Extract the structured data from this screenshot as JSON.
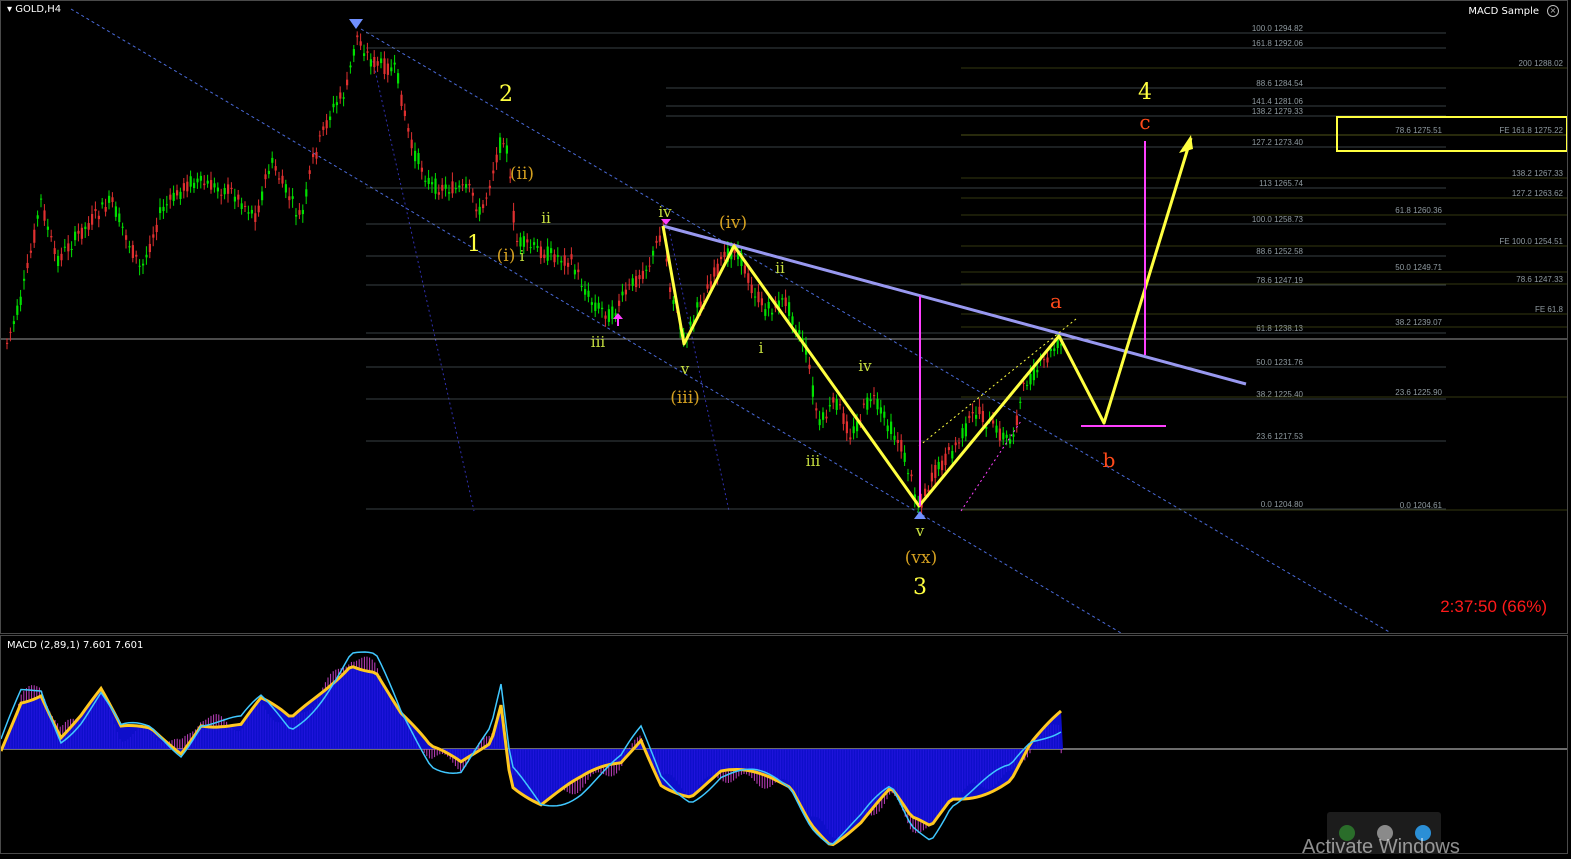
{
  "chart": {
    "symbol": "GOLD,H4",
    "indicator_title": "MACD Sample",
    "countdown": "2:37:50 (66%)",
    "colors": {
      "bull": "#00e000",
      "bear": "#e03030",
      "wave": "#ffff40",
      "pink": "#ff40ff",
      "trend": "#9898f0",
      "channel": "#4a6ad8",
      "fib": "#6f7e8a"
    }
  },
  "fib_left": [
    "100.0 1294.82",
    "161.8 1292.06",
    "88.6 1284.54",
    "141.4 1281.06",
    "138.2 1279.33",
    "127.2 1273.40",
    "113 1265.74",
    "100.0 1258.73",
    "88.6 1252.58",
    "78.6 1247.19",
    "61.8 1238.13",
    "50.0 1231.76",
    "38.2 1225.40",
    "23.6 1217.53",
    "0.0 1204.80"
  ],
  "fib_right": [
    "200 1288.02",
    "78.6 1275.51",
    "FE 161.8 1275.22",
    "138.2 1267.33",
    "127.2 1263.62",
    "61.8 1260.36",
    "FE 100.0 1254.51",
    "50.0 1249.71",
    "78.6 1247.33",
    "FE 61.8",
    "38.2 1239.07",
    "23.6 1225.90",
    "0.0 1204.61"
  ],
  "waves": {
    "w1": "1",
    "w2": "2",
    "w3": "3",
    "w4": "4",
    "i": "i",
    "ii": "ii",
    "iii": "iii",
    "iv": "iv",
    "v": "v",
    "pi": "(i)",
    "pii": "(ii)",
    "piii": "(iii)",
    "piv": "(iv)",
    "pvx": "(vx)",
    "a": "a",
    "b": "b",
    "c": "c"
  },
  "macd": {
    "label": "MACD (2,89,1) 7.601 7.601"
  },
  "watermark": "Activate Windows"
}
